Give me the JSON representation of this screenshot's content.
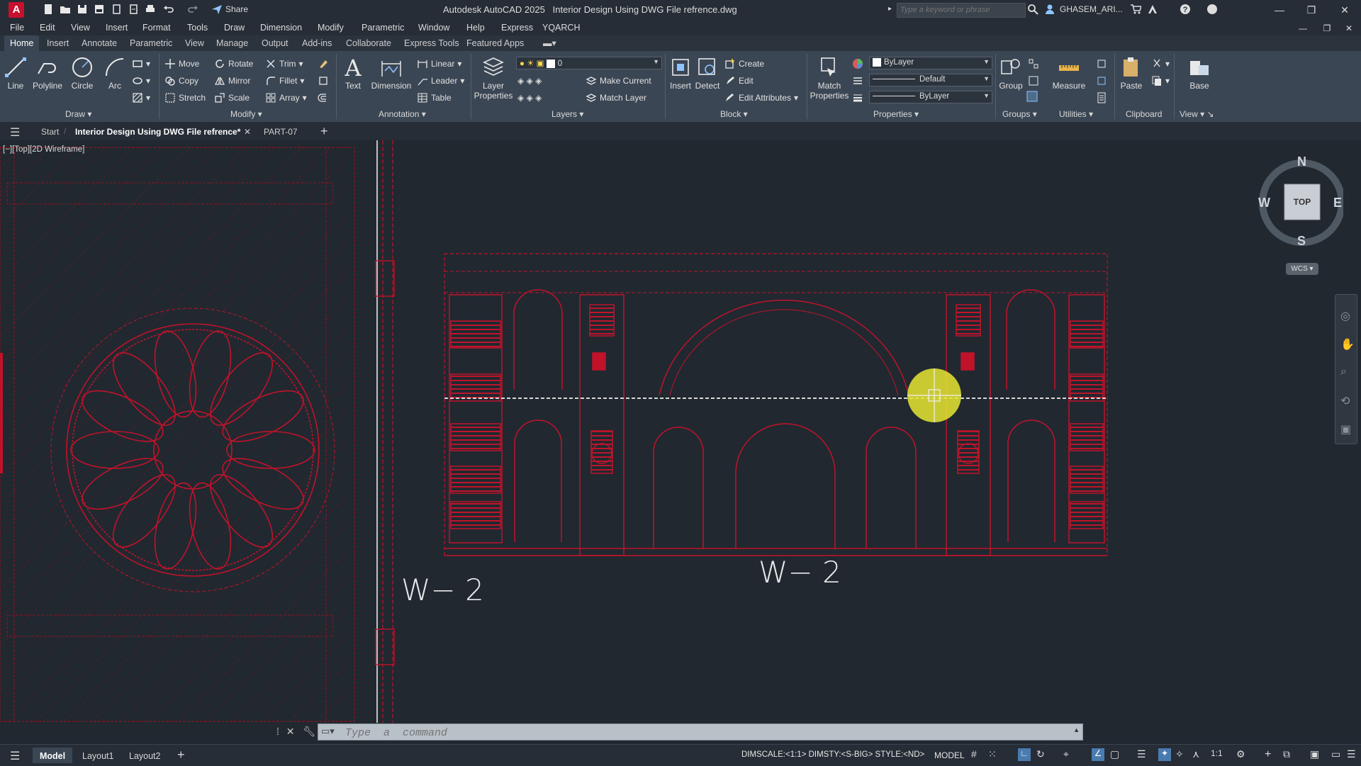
{
  "app": {
    "title": "Autodesk AutoCAD 2025",
    "filename": "Interior Design Using DWG File refrence.dwg",
    "share": "Share",
    "search_placeholder": "Type a keyword or phrase",
    "user": "GHASEM_ARI..."
  },
  "menu": [
    "File",
    "Edit",
    "View",
    "Insert",
    "Format",
    "Tools",
    "Draw",
    "Dimension",
    "Modify",
    "Parametric",
    "Window",
    "Help",
    "Express",
    "YQARCH"
  ],
  "ribbon_tabs": [
    "Home",
    "Insert",
    "Annotate",
    "Parametric",
    "View",
    "Manage",
    "Output",
    "Add-ins",
    "Collaborate",
    "Express Tools",
    "Featured Apps"
  ],
  "ribbon": {
    "draw": {
      "title": "Draw",
      "line": "Line",
      "polyline": "Polyline",
      "circle": "Circle",
      "arc": "Arc"
    },
    "modify": {
      "title": "Modify",
      "move": "Move",
      "rotate": "Rotate",
      "trim": "Trim",
      "copy": "Copy",
      "mirror": "Mirror",
      "fillet": "Fillet",
      "stretch": "Stretch",
      "scale": "Scale",
      "array": "Array"
    },
    "annotation": {
      "title": "Annotation",
      "text": "Text",
      "dimension": "Dimension",
      "linear": "Linear",
      "leader": "Leader",
      "table": "Table"
    },
    "layers": {
      "title": "Layers",
      "layer_properties_1": "Layer",
      "layer_properties_2": "Properties",
      "current_layer": "0",
      "make_current": "Make Current",
      "match_layer": "Match Layer"
    },
    "block": {
      "title": "Block",
      "insert": "Insert",
      "detect": "Detect",
      "create": "Create",
      "edit": "Edit",
      "edit_attributes": "Edit Attributes"
    },
    "properties": {
      "title": "Properties",
      "match_1": "Match",
      "match_2": "Properties",
      "color": "ByLayer",
      "linetype": "Default",
      "lineweight": "ByLayer"
    },
    "groups": {
      "title": "Groups",
      "group": "Group"
    },
    "utilities": {
      "title": "Utilities",
      "measure": "Measure"
    },
    "clipboard": {
      "title": "Clipboard",
      "paste": "Paste"
    },
    "view": {
      "title": "View",
      "base": "Base"
    }
  },
  "file_tabs": {
    "start": "Start",
    "active": "Interior Design Using DWG File refrence*",
    "other": "PART-07"
  },
  "viewport_label": "[−][Top][2D Wireframe]",
  "viewcube": {
    "n": "N",
    "s": "S",
    "e": "E",
    "w": "W",
    "face": "TOP",
    "wcs": "WCS"
  },
  "drawing": {
    "label_left": "W− 2",
    "label_right": "W− 2"
  },
  "command": {
    "placeholder": "Type  a  command"
  },
  "layout_tabs": [
    "Model",
    "Layout1",
    "Layout2"
  ],
  "status": {
    "text": "DIMSCALE:<1:1> DIMSTY:<S-BIG> STYLE:<ND>",
    "model": "MODEL",
    "scale": "1:1"
  },
  "colors": {
    "background": "#212830",
    "drawing_red": "#c0132a",
    "ribbon": "#3b4654",
    "cursor_highlight": "#e6e632"
  }
}
